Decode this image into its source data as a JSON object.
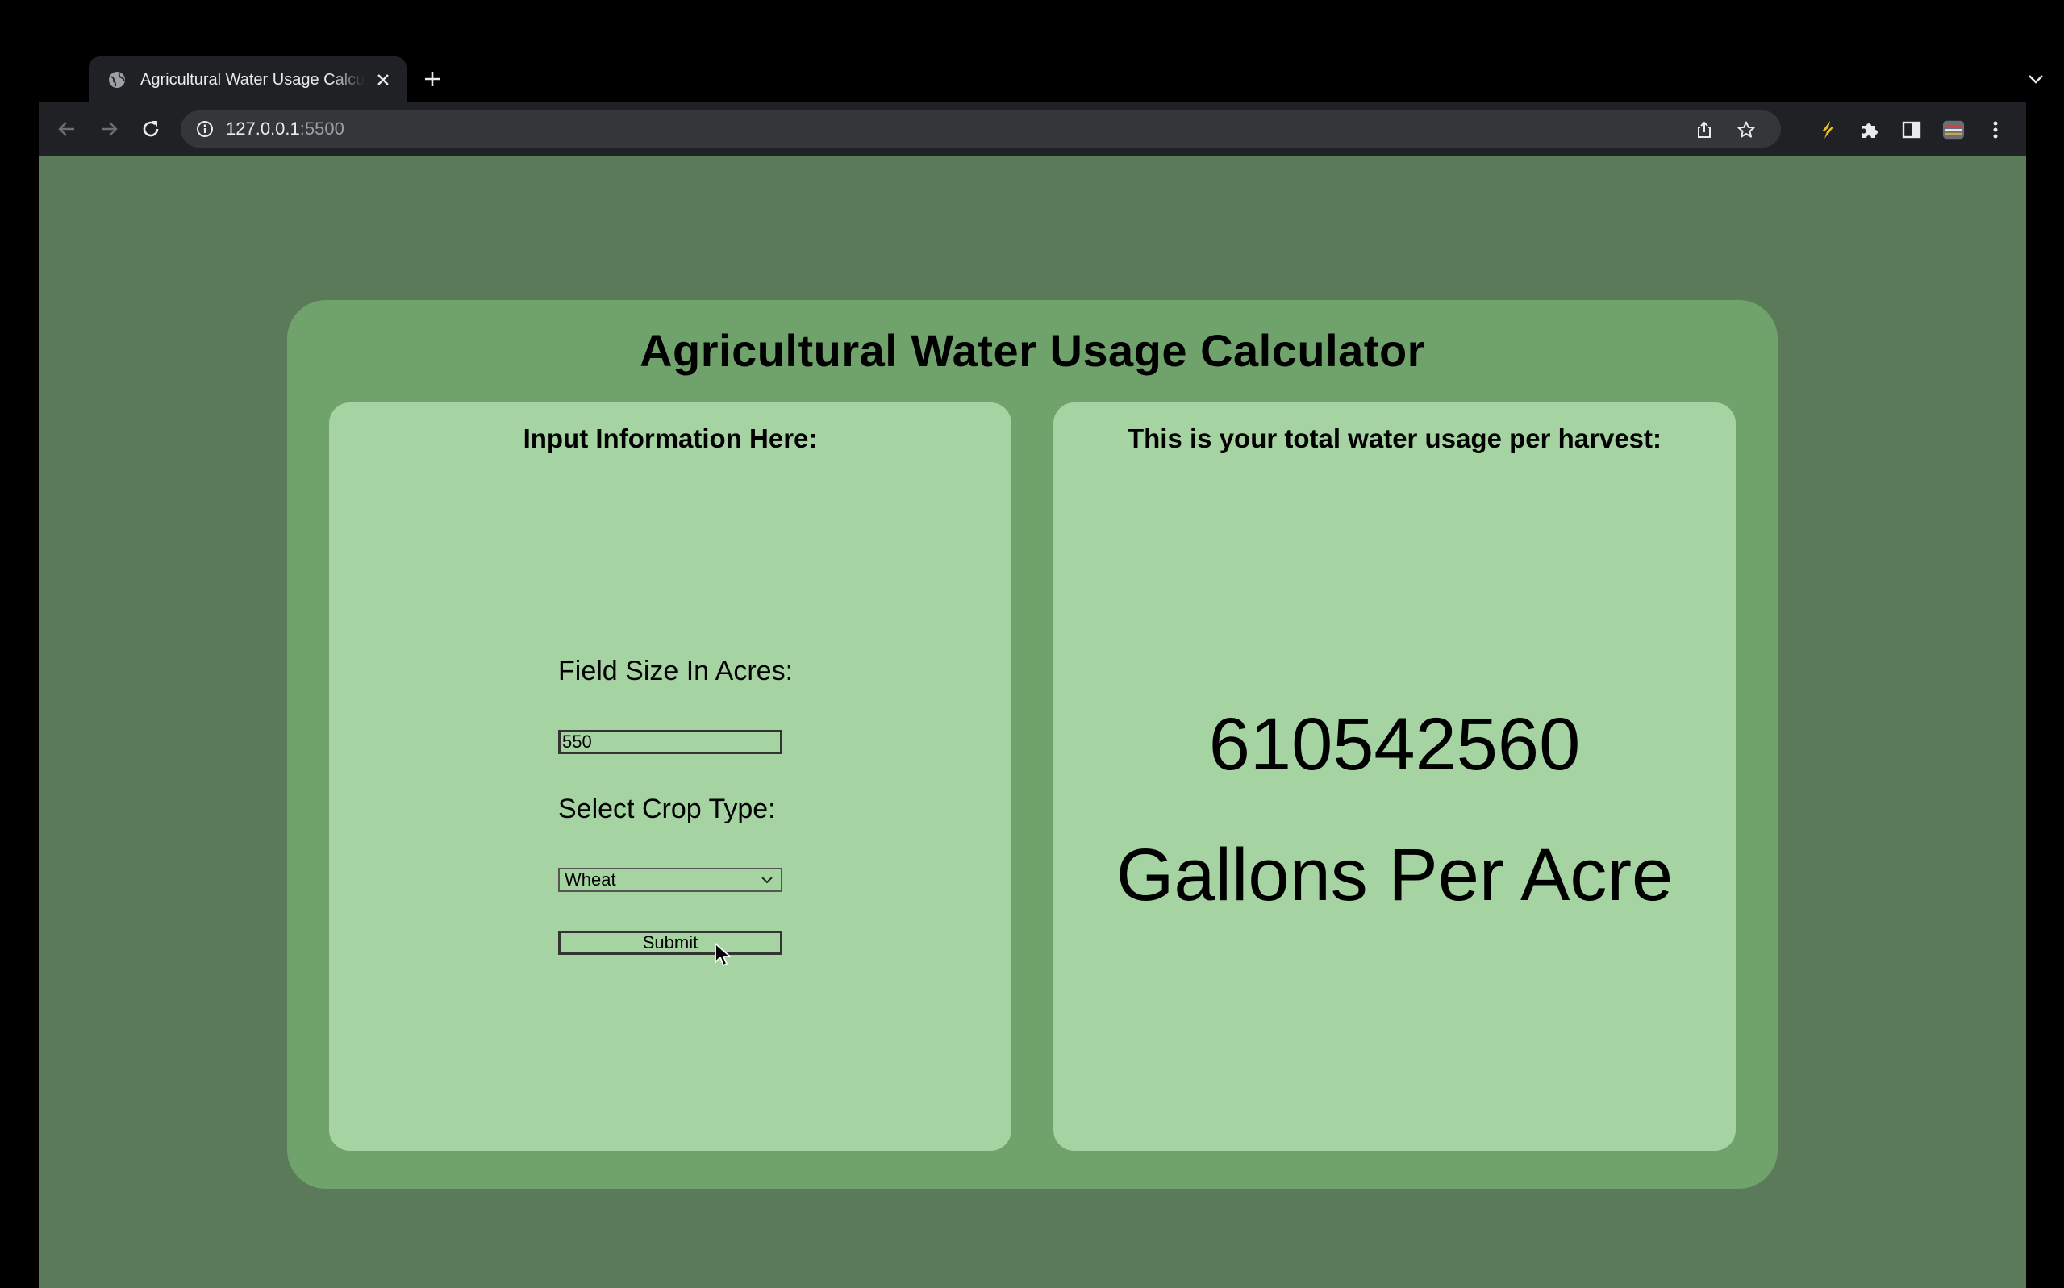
{
  "browser": {
    "tab": {
      "title": "Agricultural Water Usage Calculator",
      "favicon": "globe-icon",
      "close_icon": "close-icon"
    },
    "toolbar": {
      "url_host": "127.0.0.1",
      "url_port": ":5500",
      "icons": [
        "back-arrow-icon",
        "forward-arrow-icon",
        "reload-icon",
        "info-icon",
        "share-icon",
        "star-icon",
        "lightning-extension-icon",
        "puzzle-extension-icon",
        "side-panel-icon",
        "profile-icon",
        "kebab-menu-icon"
      ]
    },
    "colors": {
      "frame": "#000000",
      "toolbar": "#202124",
      "omnibox": "#35363a"
    }
  },
  "page": {
    "title": "Agricultural Water Usage Calculator",
    "input_panel": {
      "heading": "Input Information Here:",
      "field_size_label": "Field Size In Acres:",
      "field_size_value": "550",
      "crop_label": "Select Crop Type:",
      "crop_selected": "Wheat",
      "submit_label": "Submit"
    },
    "result_panel": {
      "heading": "This is your total water usage per harvest:",
      "value": "610542560",
      "unit": "Gallons Per Acre"
    },
    "colors": {
      "background": "#5a7a5a",
      "card": "#6fa36b",
      "panel": "#a5d3a2"
    }
  }
}
